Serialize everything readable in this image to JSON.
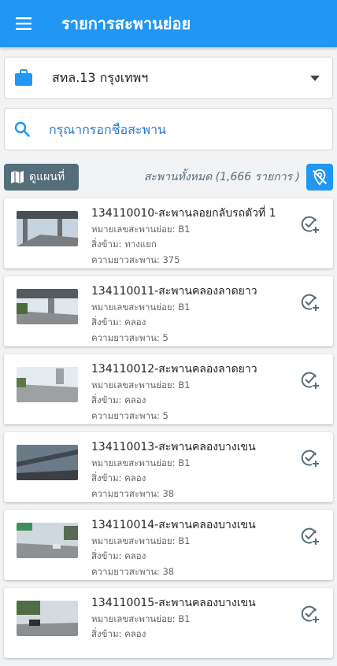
{
  "header": {
    "title": "รายการสะพานย่อย"
  },
  "filter": {
    "selected": "สทล.13 กรุงเทพฯ"
  },
  "search": {
    "placeholder": "กรุณากรอกชื่อสะพาน"
  },
  "toolbar": {
    "map_label": "ดูแผนที่",
    "total_text": "สะพานทั้งหมด (1,666 รายการ )"
  },
  "items": [
    {
      "title": "134110010-สะพานลอยกลับรถตัวที่ 1",
      "code": "หมายเลขสะพานย่อย: B1",
      "crossing": "สิ่งข้าม: ทางแยก",
      "length": "ความยาวสะพาน: 375"
    },
    {
      "title": "134110011-สะพานคลองลาดยาว",
      "code": "หมายเลขสะพานย่อย: B1",
      "crossing": "สิ่งข้าม: คลอง",
      "length": "ความยาวสะพาน: 5"
    },
    {
      "title": "134110012-สะพานคลองลาดยาว",
      "code": "หมายเลขสะพานย่อย: B1",
      "crossing": "สิ่งข้าม: คลอง",
      "length": "ความยาวสะพาน: 5"
    },
    {
      "title": "134110013-สะพานคลองบางเขน",
      "code": "หมายเลขสะพานย่อย: B1",
      "crossing": "สิ่งข้าม: คลอง",
      "length": "ความยาวสะพาน: 38"
    },
    {
      "title": "134110014-สะพานคลองบางเขน",
      "code": "หมายเลขสะพานย่อย: B1",
      "crossing": "สิ่งข้าม: คลอง",
      "length": "ความยาวสะพาน: 38"
    },
    {
      "title": "134110015-สะพานคลองบางเขน",
      "code": "หมายเลขสะพานย่อย: B1",
      "crossing": "สิ่งข้าม: คลอง",
      "length": ""
    }
  ],
  "colors": {
    "primary": "#2196f3",
    "map_button": "#546e7a",
    "icon": "#546e7a"
  }
}
